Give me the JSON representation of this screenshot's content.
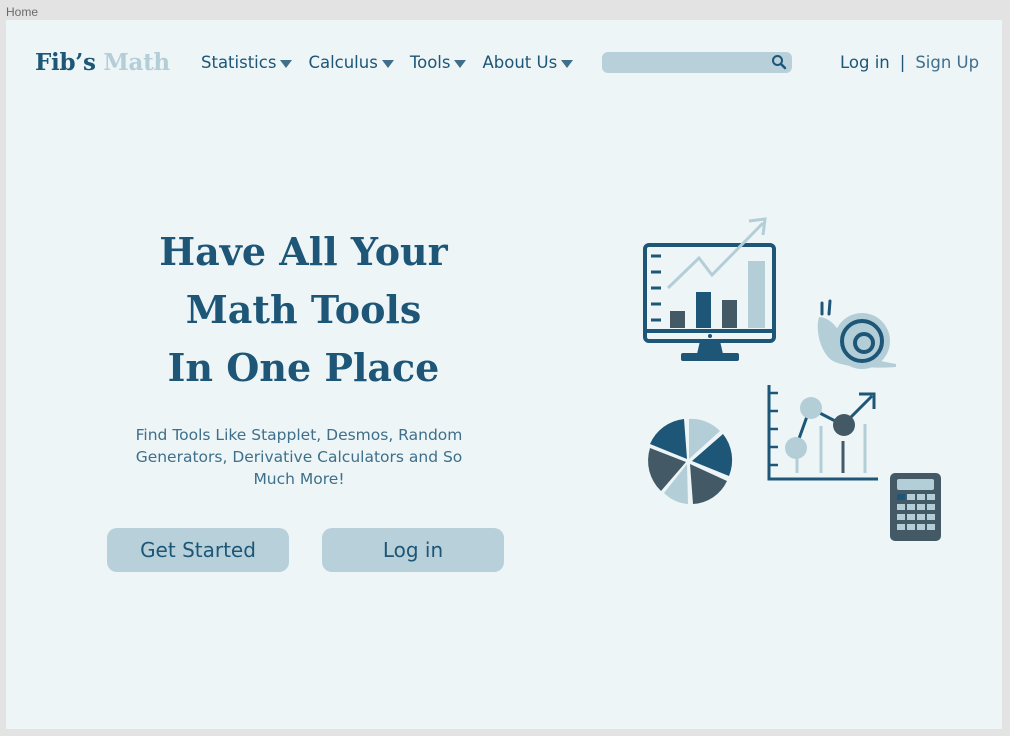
{
  "frame": {
    "label": "Home"
  },
  "brand": {
    "name_part1": "Fib’s",
    "name_part2": "Math"
  },
  "nav": {
    "items": [
      {
        "label": "Statistics"
      },
      {
        "label": "Calculus"
      },
      {
        "label": "Tools"
      },
      {
        "label": "About Us"
      }
    ]
  },
  "search": {
    "value": "",
    "placeholder": ""
  },
  "auth": {
    "login_label": "Log in",
    "separator": "|",
    "signup_label": "Sign Up"
  },
  "hero": {
    "title_lines": [
      "Have All Your",
      "Math Tools",
      "In One Place"
    ],
    "subtitle": "Find Tools Like Stapplet, Desmos, Random Generators, Derivative Calculators and So Much More!",
    "primary_button": "Get Started",
    "secondary_button": "Log in"
  },
  "colors": {
    "page_bg": "#edf5f7",
    "primary": "#1d5677",
    "light_accent": "#b4ced8",
    "slate": "#435a66"
  },
  "icons": [
    "search-icon",
    "monitor-chart-icon",
    "snail-icon",
    "pie-chart-icon",
    "scatter-chart-icon",
    "calculator-icon"
  ]
}
